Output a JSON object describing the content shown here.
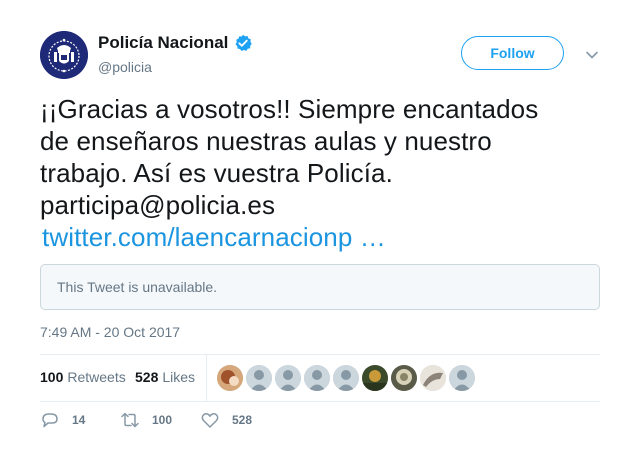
{
  "author": {
    "name": "Policía Nacional",
    "handle": "@policia",
    "verified": true
  },
  "follow_label": "Follow",
  "tweet": {
    "lines": [
      "¡¡Gracias a vosotros!! Siempre encantados",
      "de enseñaros nuestras aulas y nuestro",
      "trabajo. Así es vuestra Policía.",
      "participa@policia.es"
    ],
    "link": "twitter.com/laencarnacionp …"
  },
  "quoted_tweet": {
    "message": "This Tweet is unavailable."
  },
  "timestamp": "7:49 AM - 20 Oct 2017",
  "stats": {
    "retweets_count": "100",
    "retweets_label": "Retweets",
    "likes_count": "528",
    "likes_label": "Likes"
  },
  "actions": {
    "reply_count": "14",
    "retweet_count": "100",
    "like_count": "528"
  },
  "colors": {
    "accent": "#1da1f2",
    "link": "#1b95e0",
    "muted_text": "#657786",
    "avatar_bg": "#1e2a78"
  },
  "icons": {
    "verified": "verified-badge-icon",
    "more": "chevron-down-icon",
    "reply": "reply-icon",
    "retweet": "retweet-icon",
    "like": "heart-icon"
  }
}
